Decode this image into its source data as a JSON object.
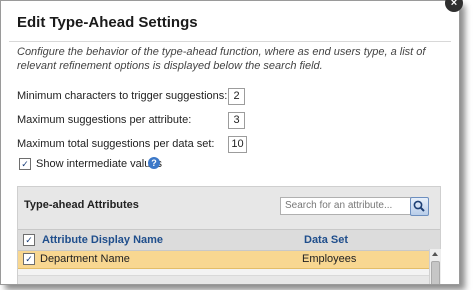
{
  "dialog": {
    "title": "Edit Type-Ahead Settings",
    "close_label": "×",
    "description": "Configure the behavior of the type-ahead function, where as end users type, a list of relevant refinement options is displayed below the search field."
  },
  "settings": {
    "min_chars_label": "Minimum characters to trigger suggestions:",
    "min_chars_value": "2",
    "max_per_attribute_label": "Maximum suggestions per attribute:",
    "max_per_attribute_value": "3",
    "max_total_label": "Maximum total suggestions per data set:",
    "max_total_value": "10",
    "show_intermediate_label": "Show intermediate values",
    "show_intermediate_checked": "✓",
    "help_label": "?"
  },
  "attributes_panel": {
    "title": "Type-ahead Attributes",
    "search_placeholder": "Search for an attribute...",
    "columns": {
      "name": "Attribute Display Name",
      "dataset": "Data Set"
    },
    "header_check": "✓",
    "rows": [
      {
        "checked": "✓",
        "name": "Department Name",
        "dataset": "Employees"
      }
    ]
  },
  "colors": {
    "selected_row": "#f8d791",
    "header_link": "#1f4e8c",
    "help_icon": "#3c78c8"
  }
}
